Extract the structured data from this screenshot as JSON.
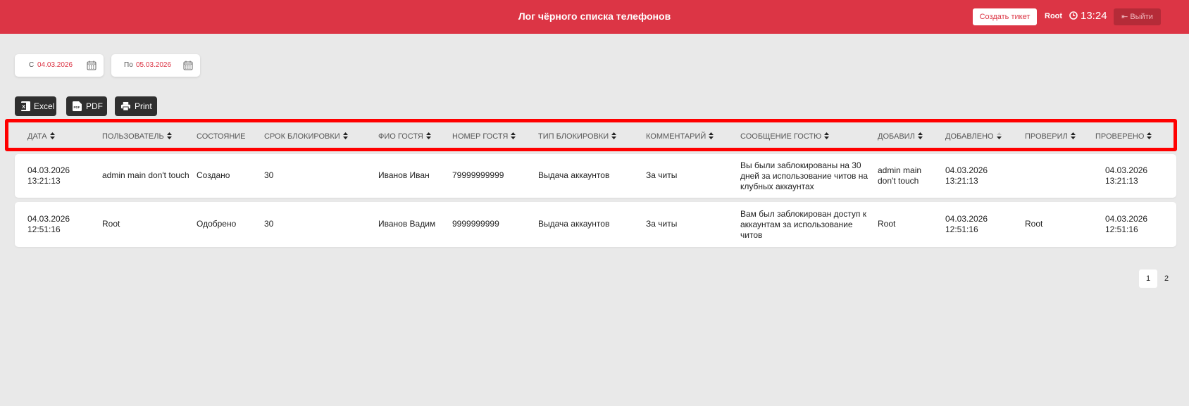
{
  "header": {
    "title": "Лог чёрного списка телефонов",
    "create_ticket": "Создать тикет",
    "user": "Root",
    "time": "13:24",
    "logout": "Выйти"
  },
  "filters": {
    "from_prefix": "С",
    "from_value": "04.03.2026",
    "to_prefix": "По",
    "to_value": "05.03.2026"
  },
  "export": {
    "excel": "Excel",
    "pdf": "PDF",
    "print": "Print"
  },
  "table": {
    "columns": [
      "ДАТА",
      "ПОЛЬЗОВАТЕЛЬ",
      "СОСТОЯНИЕ",
      "СРОК БЛОКИРОВКИ",
      "ФИО ГОСТЯ",
      "НОМЕР ГОСТЯ",
      "ТИП БЛОКИРОВКИ",
      "КОММЕНТАРИЙ",
      "СООБЩЕНИЕ ГОСТЮ",
      "ДОБАВИЛ",
      "ДОБАВЛЕНО",
      "ПРОВЕРИЛ",
      "ПРОВЕРЕНО"
    ],
    "rows": [
      {
        "date_line1": "04.03.2026",
        "date_line2": "13:21:13",
        "user": "admin main don't touch",
        "state": "Создано",
        "term": "30",
        "guest_name": "Иванов Иван",
        "guest_phone": "79999999999",
        "block_type": "Выдача аккаунтов",
        "comment": "За читы",
        "message_l1": "Вы были заблокированы на 30",
        "message_l2": "дней за использование читов на",
        "message_l3": "клубных аккаунтах",
        "added_by_l1": "admin main",
        "added_by_l2": "don't touch",
        "added_l1": "04.03.2026",
        "added_l2": "13:21:13",
        "checked_by": "",
        "checked_l1": "04.03.2026",
        "checked_l2": "13:21:13"
      },
      {
        "date_line1": "04.03.2026",
        "date_line2": "12:51:16",
        "user": "Root",
        "state": "Одобрено",
        "term": "30",
        "guest_name": "Иванов Вадим",
        "guest_phone": "9999999999",
        "block_type": "Выдача аккаунтов",
        "comment": "За читы",
        "message_l1": "Вам был заблокирован доступ к",
        "message_l2": "аккаунтам за использование",
        "message_l3": "читов",
        "added_by_l1": "Root",
        "added_by_l2": "",
        "added_l1": "04.03.2026",
        "added_l2": "12:51:16",
        "checked_by": "Root",
        "checked_l1": "04.03.2026",
        "checked_l2": "12:51:16"
      }
    ]
  },
  "pagination": {
    "pages": [
      "1",
      "2"
    ],
    "current": "1"
  },
  "colors": {
    "brand": "#dc3545",
    "highlight": "#ff0000",
    "dark_button": "#2f2f2f"
  },
  "icons": [
    "clock-icon",
    "logout-icon",
    "calendar-icon",
    "excel-icon",
    "pdf-icon",
    "print-icon",
    "sort-icon"
  ]
}
